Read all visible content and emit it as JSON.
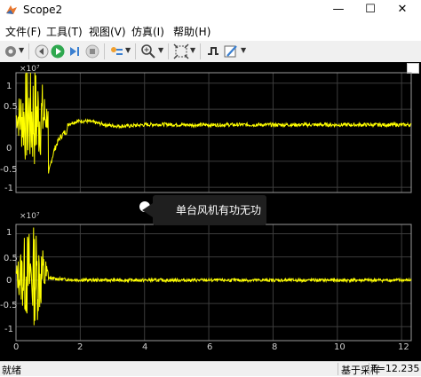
{
  "window": {
    "title": "Scope2",
    "minimize": "—",
    "maximize": "☐",
    "close": "✕"
  },
  "menu": [
    "文件(F)",
    "工具(T)",
    "视图(V)",
    "仿真(I)",
    "帮助(H)"
  ],
  "colors": {
    "signal": "#ffff00",
    "background": "#000000",
    "axis": "#9a9a9a"
  },
  "plots": [
    {
      "exponent": "×10⁷",
      "y_ticks": [
        "1",
        "0.5",
        "0",
        "-0.5",
        "-1"
      ],
      "x_ticks": [],
      "ylim": [
        -1.1,
        1.2
      ],
      "steady_value": 0.2
    },
    {
      "exponent": "×10⁷",
      "y_ticks": [
        "1",
        "0.5",
        "0",
        "-0.5",
        "-1"
      ],
      "x_ticks": [
        "0",
        "2",
        "4",
        "6",
        "8",
        "10",
        "12"
      ],
      "ylim": [
        -1.3,
        1.2
      ],
      "steady_value": 0.0
    }
  ],
  "chart_data": [
    {
      "type": "line",
      "series": [
        {
          "values": []
        }
      ],
      "xlim": [
        0,
        12.3
      ],
      "ylim": [
        -1.1,
        1.2
      ],
      "grid": true
    },
    {
      "type": "line",
      "series": [
        {
          "values": []
        }
      ],
      "xlim": [
        0,
        12.3
      ],
      "ylim": [
        -1.3,
        1.2
      ],
      "grid": true
    }
  ],
  "tooltip": "单台风机有功无功",
  "status": {
    "left": "就绪",
    "mode": "基于采样",
    "time": "T=12.235"
  }
}
